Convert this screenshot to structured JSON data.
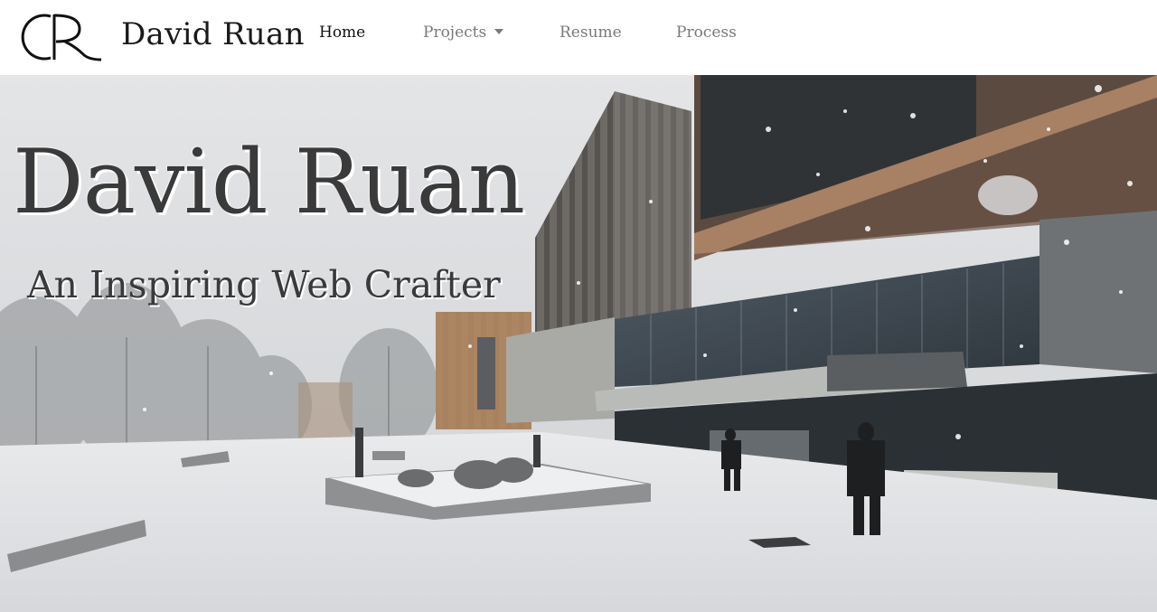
{
  "nav": {
    "logo_text": "DR",
    "brand": "David Ruan",
    "links": [
      {
        "label": "Home",
        "active": true
      },
      {
        "label": "Projects",
        "has_dropdown": true
      },
      {
        "label": "Resume"
      },
      {
        "label": "Process"
      }
    ]
  },
  "hero": {
    "title": "David Ruan",
    "subtitle": "An Inspiring Web Crafter",
    "background": "snowy-campus-building-photo"
  },
  "colors": {
    "nav_bg": "#ffffff",
    "nav_active": "#111111",
    "nav_inactive": "#7a7a7a",
    "hero_text": "#3a3a3a"
  }
}
